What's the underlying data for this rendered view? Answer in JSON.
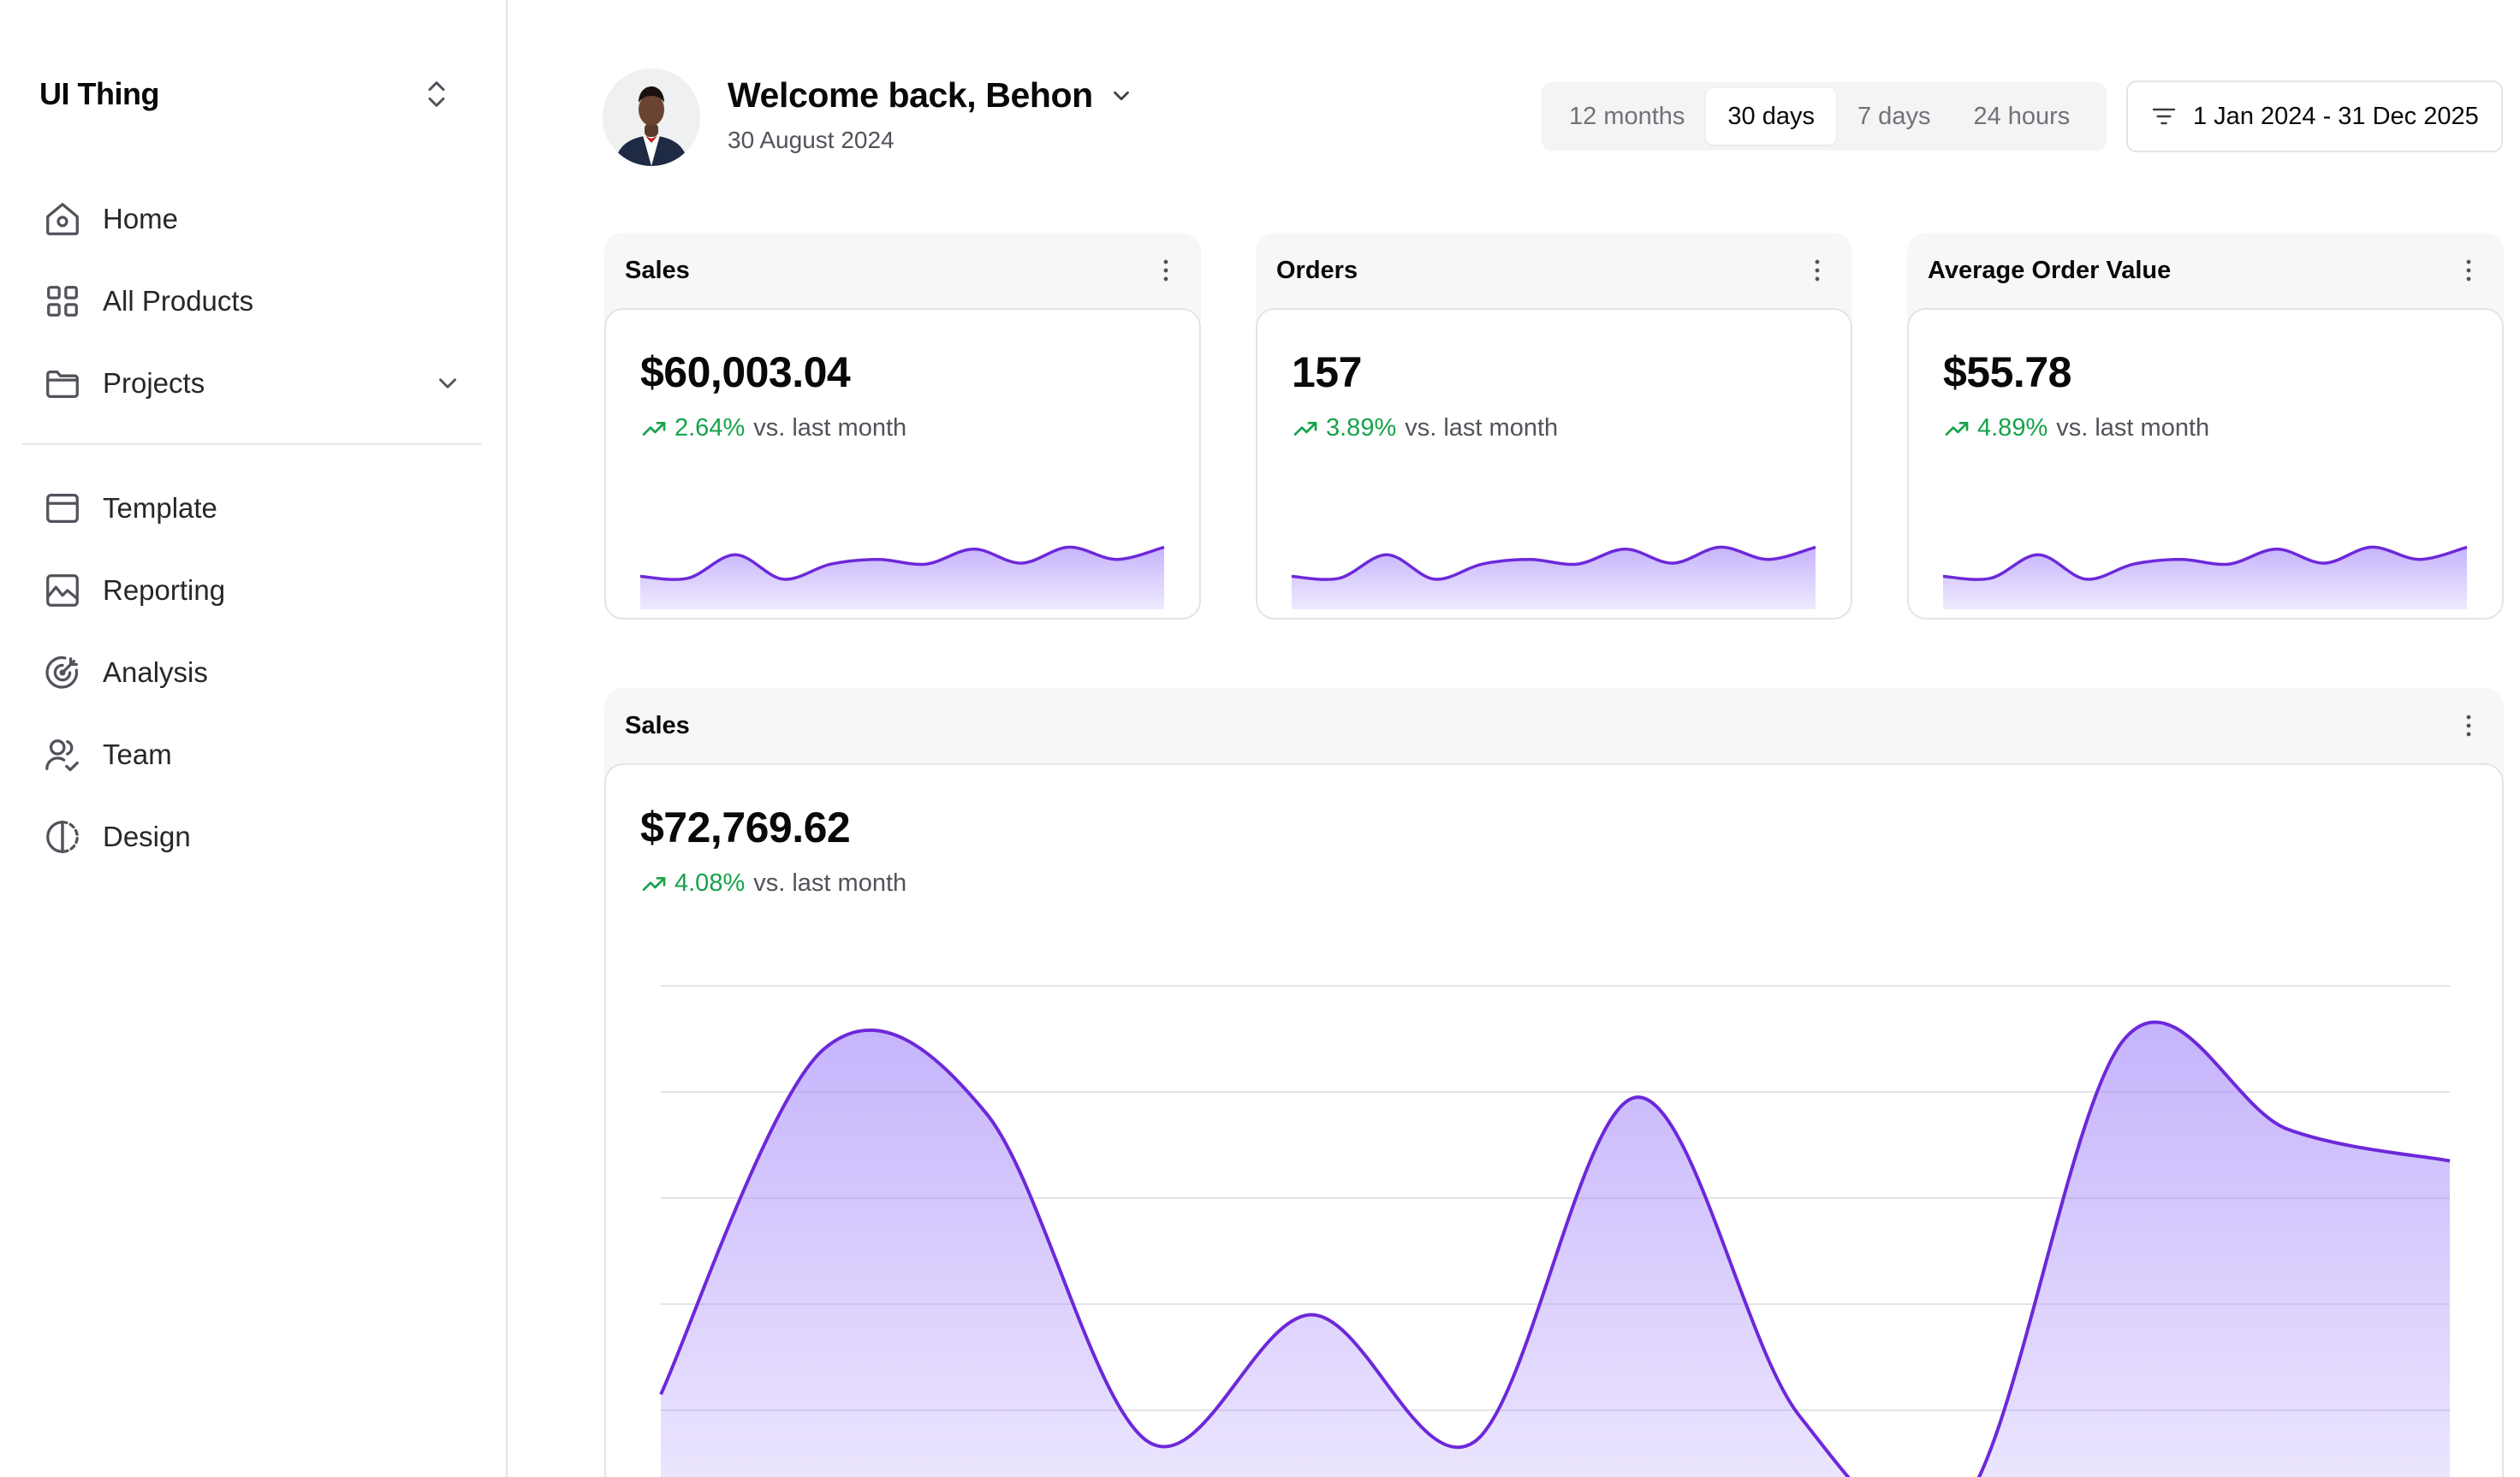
{
  "sidebar": {
    "brand": "UI Thing",
    "items": [
      {
        "label": "Home",
        "icon": "home-icon"
      },
      {
        "label": "All Products",
        "icon": "grid-icon"
      },
      {
        "label": "Projects",
        "icon": "folder-icon",
        "expandable": true
      },
      {
        "label": "Template",
        "icon": "template-icon"
      },
      {
        "label": "Reporting",
        "icon": "chart-icon"
      },
      {
        "label": "Analysis",
        "icon": "target-icon"
      },
      {
        "label": "Team",
        "icon": "users-icon"
      },
      {
        "label": "Design",
        "icon": "contrast-icon"
      }
    ]
  },
  "header": {
    "welcome": "Welcome back, Behon",
    "date": "30 August 2024",
    "ranges": [
      "12 months",
      "30 days",
      "7 days",
      "24 hours"
    ],
    "active_range": "30 days",
    "date_range": "1 Jan 2024 - 31 Dec 2025"
  },
  "cards": [
    {
      "title": "Sales",
      "value": "$60,003.04",
      "change": "2.64%",
      "vs": "vs. last month"
    },
    {
      "title": "Orders",
      "value": "157",
      "change": "3.89%",
      "vs": "vs. last month"
    },
    {
      "title": "Average Order Value",
      "value": "$55.78",
      "change": "4.89%",
      "vs": "vs. last month"
    }
  ],
  "big_card": {
    "title": "Sales",
    "value": "$72,769.62",
    "change": "4.08%",
    "vs": "vs. last month"
  },
  "colors": {
    "accent": "#6d28d9",
    "accent_fill_top": "#a78bfa",
    "positive": "#16a34a",
    "muted": "#52525b"
  },
  "chart_data": [
    {
      "type": "area",
      "series": [
        {
          "values": [
            3.5,
            3.3,
            5.8,
            3.2,
            4.8,
            5.3,
            4.8,
            6.4,
            4.9,
            6.6,
            5.3,
            6.6
          ]
        }
      ],
      "ylim": [
        0,
        10
      ],
      "grid": false
    },
    {
      "type": "area",
      "series": [
        {
          "values": [
            2.3,
            8.8,
            7.6,
            1.4,
            3.8,
            1.4,
            7.9,
            1.9,
            0.2,
            9.0,
            7.3,
            6.7
          ]
        }
      ],
      "ylim": [
        0,
        10
      ],
      "grid": true
    }
  ]
}
